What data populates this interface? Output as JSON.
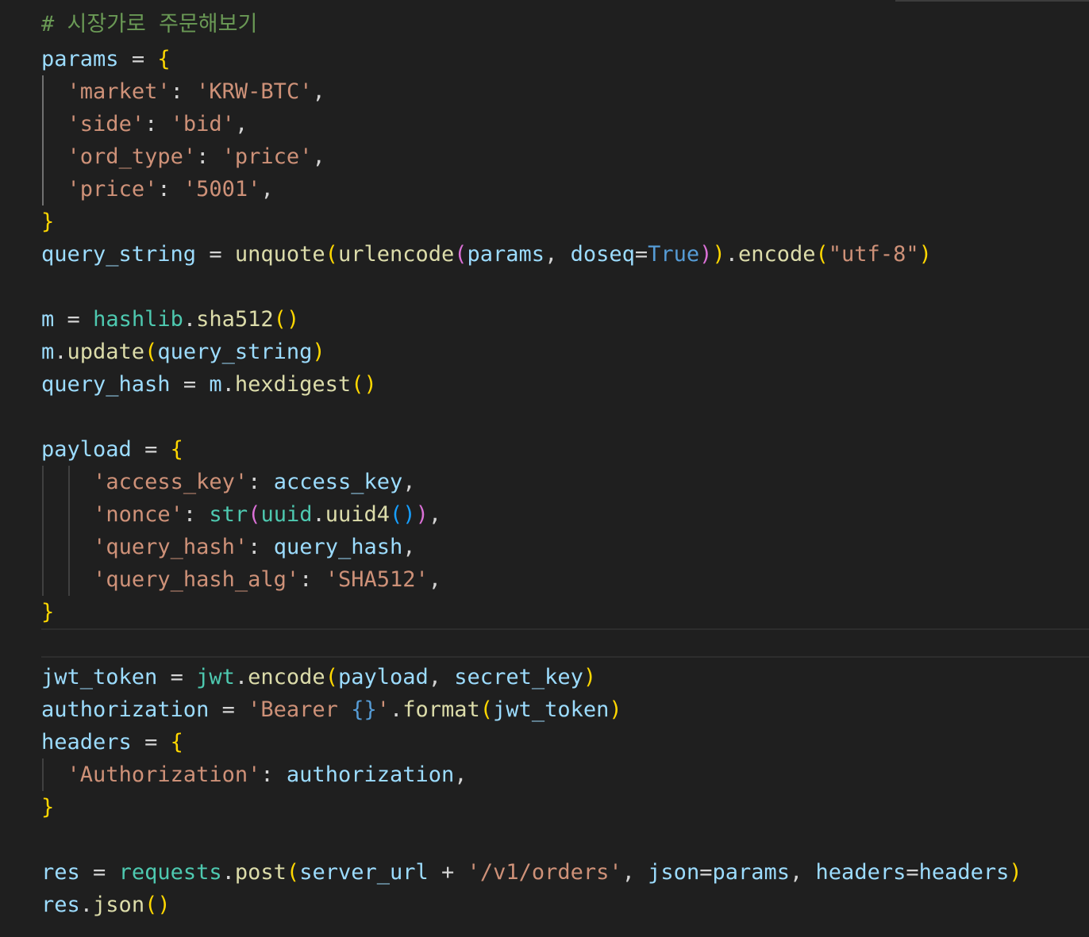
{
  "editor": {
    "language": "python",
    "theme": {
      "background": "#1f1f1f",
      "comment": "#6a9955",
      "variable": "#9cdcfe",
      "string": "#ce9178",
      "function": "#dcdcaa",
      "module": "#4ec9b0",
      "keyword": "#569cd6",
      "bracket_level1": "#ffd700",
      "bracket_level2": "#da70d6",
      "bracket_level3": "#179fff"
    },
    "lines": [
      "# 시장가로 주문해보기",
      "params = {",
      "  'market': 'KRW-BTC',",
      "  'side': 'bid',",
      "  'ord_type': 'price',",
      "  'price': '5001',",
      "}",
      "query_string = unquote(urlencode(params, doseq=True)).encode(\"utf-8\")",
      "",
      "m = hashlib.sha512()",
      "m.update(query_string)",
      "query_hash = m.hexdigest()",
      "",
      "payload = {",
      "    'access_key': access_key,",
      "    'nonce': str(uuid.uuid4()),",
      "    'query_hash': query_hash,",
      "    'query_hash_alg': 'SHA512',",
      "}",
      "",
      "jwt_token = jwt.encode(payload, secret_key)",
      "authorization = 'Bearer {}'.format(jwt_token)",
      "headers = {",
      "  'Authorization': authorization,",
      "}",
      "",
      "res = requests.post(server_url + '/v1/orders', json=params, headers=headers)",
      "res.json()"
    ]
  }
}
